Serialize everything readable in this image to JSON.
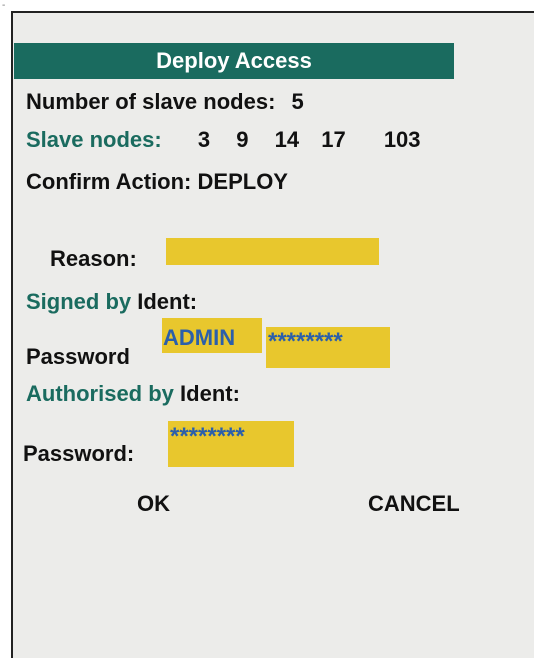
{
  "title": "Deploy Access",
  "slave_count": {
    "label": "Number  of  slave  nodes:",
    "value": "5"
  },
  "slave_nodes": {
    "label": "Slave nodes:",
    "nodes": [
      "3",
      "9",
      "14",
      "17",
      "103"
    ]
  },
  "confirm_action": {
    "label": "Confirm Action:",
    "value": "DEPLOY"
  },
  "reason": {
    "label": "Reason:",
    "value": ""
  },
  "signed_by": {
    "label_colored": "Signed by",
    "label_plain": "Ident:",
    "password_label": "Password",
    "ident_value": "ADMIN",
    "password_value": "********"
  },
  "authorised_by": {
    "label_colored": "Authorised by",
    "label_plain": "Ident:",
    "password_label": "Password:",
    "password_value": "********"
  },
  "buttons": {
    "ok": "OK",
    "cancel": "CANCEL"
  },
  "colors": {
    "title_bar": "#1a6b5f",
    "label_teal": "#1a6b5f",
    "field_yellow": "#e8c72d",
    "field_text": "#2b5faa",
    "background": "#ececea"
  }
}
